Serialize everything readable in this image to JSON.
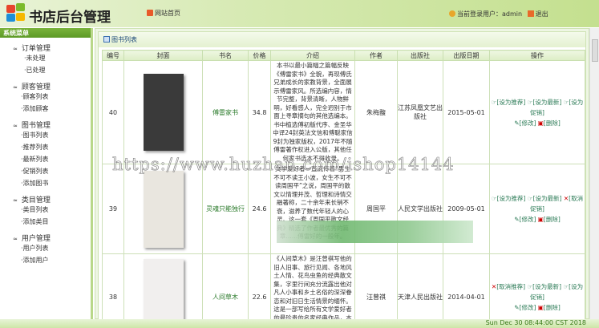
{
  "header": {
    "title": "书店后台管理",
    "home_link": "网站首页",
    "current_user_label": "当前登录用户：admin",
    "logout": "退出"
  },
  "sidebar": {
    "title": "系统菜单",
    "groups": [
      {
        "label": "订单管理",
        "items": [
          "·未处理",
          "·已处理"
        ]
      },
      {
        "label": "顾客管理",
        "items": [
          "·顾客列表",
          "·添加顾客"
        ]
      },
      {
        "label": "图书管理",
        "items": [
          "·图书列表",
          "·推荐列表",
          "·最新列表",
          "·促销列表",
          "·添加图书"
        ]
      },
      {
        "label": "类目管理",
        "items": [
          "·类目列表",
          "·添加类目"
        ]
      },
      {
        "label": "用户管理",
        "items": [
          "·用户列表",
          "·添加用户"
        ]
      }
    ]
  },
  "panel": {
    "title": "图书列表"
  },
  "table": {
    "headers": [
      "编号",
      "封面",
      "书名",
      "价格",
      "介绍",
      "作者",
      "出版社",
      "出版日期",
      "操作"
    ],
    "rows": [
      {
        "id": "40",
        "name": "傅雷家书",
        "price": "34.8",
        "intro": "本书以最小篇幅之篇幅反映《傅雷家书》全貌，再现傅氏兄弟成长的家教背景，全面展示傅雷家风。所选编内容，情节完整，背景清晰，人物鲜明，好看感人，完全迥别于市面上寻章摘句的其他选编本。书中植选傅初版代序、金圣华中译24封英法文信和傅聪家信9封为独家版权，2017年不随傅雷著作权进入公版，其他任何家书选本不得收录。",
        "author": "朱梅馥",
        "publisher": "江苏凤凰文艺出版社",
        "date": "2015-05-01",
        "ops": [
          "[设为推荐]",
          "[设为最新]",
          "[设为促销]",
          "[修改]",
          "[删除]"
        ],
        "cover": "#3a3a3a"
      },
      {
        "id": "39",
        "name": "灵魂只能独行",
        "price": "24.6",
        "intro": "文学爱好者一直流传着“男生不可不读王小波，女生不可不读周国平”之说，周国平的散文以情理并茂、哲理和诗情交融著称，二十余年来长销不衰，滋养了数代年轻人的心灵。这一套《周国平散文经典》精选了作者最优秀的篇章……傅雷好的一般年。",
        "author": "周国平",
        "publisher": "人民文学出版社",
        "date": "2009-05-01",
        "ops": [
          "[设为推荐]",
          "[设为最新]",
          "[取消促销]",
          "[修改]",
          "[删除]"
        ],
        "cover": "#e9e6df"
      },
      {
        "id": "38",
        "name": "人间草木",
        "price": "22.6",
        "intro": "《人间草木》是汪曾祺写他的旧人旧事、旅行见闻、各地风土人情、花鸟虫鱼的经典散文集，字里行间充分流露出他对凡人小事和乡土名俗的深深眷恋和对旧日生活情景的缅怀。 这是一部写给所有文学爱好者的最珍贵的名家经典作品，本书通过精选汪曾祺先生的经典散文……",
        "author": "汪曾祺",
        "publisher": "天津人民出版社",
        "date": "2014-04-01",
        "ops": [
          "[取消推荐]",
          "[设为最新]",
          "[设为促销]",
          "[修改]",
          "[删除]"
        ],
        "cover": "#f1efee"
      }
    ]
  },
  "status": {
    "datetime": "Sun Dec 30 08:44:00 CST 2018"
  },
  "watermark": "https://www.huzhan.com/ishop14144"
}
